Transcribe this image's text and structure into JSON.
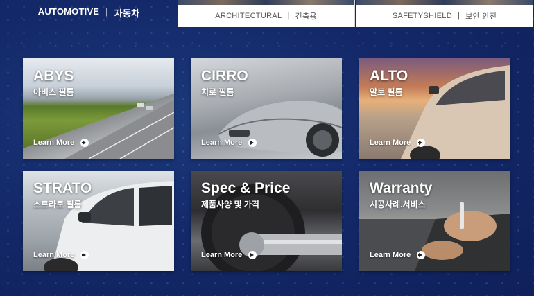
{
  "tabs": {
    "automotive": {
      "en": "AUTOMOTIVE",
      "sep": "|",
      "ko": "자동차"
    },
    "architectural": {
      "en": "ARCHITECTURAL",
      "sep": "|",
      "ko": "건축용"
    },
    "safety": {
      "en": "SAFETYSHIELD",
      "sep": "|",
      "ko": "보안.안전"
    }
  },
  "cards": [
    {
      "title": "ABYS",
      "subtitle": "아비스 필름",
      "more": "Learn More"
    },
    {
      "title": "CIRRO",
      "subtitle": "치로 필름",
      "more": "Learn More"
    },
    {
      "title": "ALTO",
      "subtitle": "알토 필름",
      "more": "Learn More"
    },
    {
      "title": "STRATO",
      "subtitle": "스트라토 필름",
      "more": "Learn More"
    },
    {
      "title": "Spec & Price",
      "subtitle": "제품사양 및 가격",
      "more": "Learn More"
    },
    {
      "title": "Warranty",
      "subtitle": "시공사례.서비스",
      "more": "Learn More"
    }
  ],
  "colors": {
    "background": "#14296a",
    "tab_text": "#555555",
    "text": "#ffffff"
  }
}
